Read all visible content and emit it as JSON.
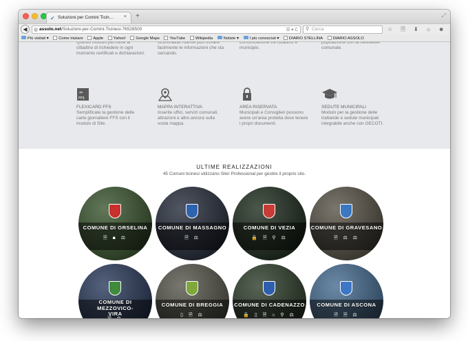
{
  "browser": {
    "tab_title": "Soluzioni per Comini Ticin…",
    "tab_close": "×",
    "new_tab": "+",
    "back": "◀",
    "url_host": "assolo.net",
    "url_path": "/Soluzioni-per-Comini-Ticinesi-76528500",
    "url_controls": "☰ ▾ C",
    "search_placeholder": "Cerca",
    "toolbar_icons": "☆ 🗎 ⬇ ⌂ ☻ ≡",
    "bookmarks": [
      {
        "label": "Più visitati ▾",
        "type": "folder"
      },
      {
        "label": "Come iniziare",
        "type": "page"
      },
      {
        "label": "Apple",
        "type": "page"
      },
      {
        "label": "Yahoo!",
        "type": "page"
      },
      {
        "label": "Google Maps",
        "type": "page"
      },
      {
        "label": "YouTube",
        "type": "page"
      },
      {
        "label": "Wikipedia",
        "type": "page"
      },
      {
        "label": "Notizie ▾",
        "type": "folder"
      },
      {
        "label": "I più conosciuti ▾",
        "type": "folder"
      },
      {
        "label": "DIARIO STELLINA",
        "type": "page"
      },
      {
        "label": "DIARIO ASSOLO",
        "type": "page"
      }
    ]
  },
  "features_top": [
    "Questo modulo permette al cittadino di richiedere in ogni momento certificati e dichiarazioni.",
    "funzionalità l'utente può trovare facilmente le informazioni che sta cercando.",
    "comunicazione tra cittadino e municipio.",
    "popolazione con la newsletter comunale."
  ],
  "features": [
    {
      "title": "FLEXICARD FFS",
      "text": "Semplificate la gestione delle carte giornaliere FFS con il modulo di Site.",
      "icon": "flexicard-icon"
    },
    {
      "title": "MAPPA INTERATTIVA",
      "text": "Inserite uffici, servizi comunali, attrazioni e altro ancora sulla vosta mappa.",
      "icon": "map-pin-icon"
    },
    {
      "title": "AREA RISERVATA",
      "text": "Municipali e Consiglieri possono avere un'area protetta dove tenere i propri documenti.",
      "icon": "lock-icon"
    },
    {
      "title": "SEDUTE MUNICIPALI",
      "text": "Modulo per la gestione delle trattande e sedute municipali integrabile anche con GECOTI.",
      "icon": "graduation-cap-icon"
    }
  ],
  "results": {
    "title": "ULTIME REALIZZAZIONI",
    "subtitle": "45 Comuni ticinesi utilizzano Site! Professional per gestire il proprio sito."
  },
  "municipalities": [
    {
      "name": "COMUNE DI ORSELINA",
      "icons": "🗎 ☗ ⚖",
      "bg": "#3f5a34",
      "crest": "#c8302c"
    },
    {
      "name": "COMUNE DI MASSAGNO",
      "icons": "🗎 ⚖",
      "bg": "#2b3240",
      "crest": "#2e63b0"
    },
    {
      "name": "COMUNE DI VEZIA",
      "icons": "🔒 🗎 ⚲ ⚖",
      "bg": "#243224",
      "crest": "#c93c35"
    },
    {
      "name": "COMUNE DI GRAVESANO",
      "icons": "🗎 ⚖ ⚖",
      "bg": "#5c574c",
      "crest": "#3a78c2"
    },
    {
      "name": "COMUNE DI MEZZOVICO-VIRA",
      "icons": "🗎 ⚖",
      "bg": "#2f3f5f",
      "crest": "#3f8a3c"
    },
    {
      "name": "COMUNE DI BREGGIA",
      "icons": "▯ 🗎 ⚖",
      "bg": "#5b5a50",
      "crest": "#7ea83a"
    },
    {
      "name": "COMUNE DI CADENAZZO",
      "icons": "🔒 ▯ 🗎 ⌂ ⚲ ⚖",
      "bg": "#32422f",
      "crest": "#2e5fae"
    },
    {
      "name": "COMUNE DI ASCONA",
      "icons": "🗎 🗎 ⚖",
      "bg": "#4a6f93",
      "crest": "#3d77c5"
    }
  ]
}
